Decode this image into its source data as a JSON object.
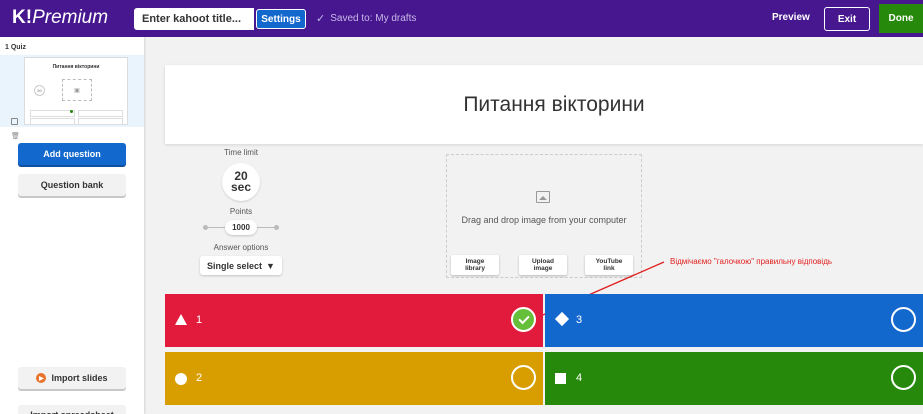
{
  "app": {
    "logo_mark": "K!",
    "logo_word": "Premium",
    "title_placeholder": "Enter kahoot title...",
    "settings_label": "Settings",
    "saved_text": "Saved to: My drafts",
    "preview_label": "Preview",
    "exit_label": "Exit",
    "done_label": "Done"
  },
  "sidebar": {
    "quiz_label": "1  Quiz",
    "thumb_title": "Питання вікторини",
    "thumb_timer": "20",
    "add_question": "Add question",
    "question_bank": "Question bank",
    "import_slides": "Import slides",
    "import_spreadsheet": "Import spreadsheet"
  },
  "question": {
    "title": "Питання вікторини"
  },
  "settings": {
    "time_limit_label": "Time limit",
    "time_value": "20",
    "time_unit": "sec",
    "points_label": "Points",
    "points_value": "1000",
    "answer_options_label": "Answer options",
    "answer_option_value": "Single select"
  },
  "media": {
    "drag_text": "Drag and drop image from your computer",
    "image_library": "Image\nlibrary",
    "upload_image": "Upload\nimage",
    "youtube_link": "YouTube\nlink"
  },
  "annotation": {
    "text": "Відмічаємо \"галочкою\" правильну відповідь",
    "color": "#e0201f"
  },
  "answers": [
    {
      "text": "1",
      "shape": "triangle",
      "color": "#e21b3c",
      "correct": true
    },
    {
      "text": "2",
      "shape": "circle",
      "color": "#d89e00",
      "correct": false
    },
    {
      "text": "3",
      "shape": "diamond",
      "color": "#1368ce",
      "correct": false
    },
    {
      "text": "4",
      "shape": "square",
      "color": "#26890c",
      "correct": false
    }
  ],
  "colors": {
    "topbar": "#46178f",
    "accent_blue": "#1368ce",
    "done_green": "#26890c",
    "correct_check": "#66bf39"
  }
}
